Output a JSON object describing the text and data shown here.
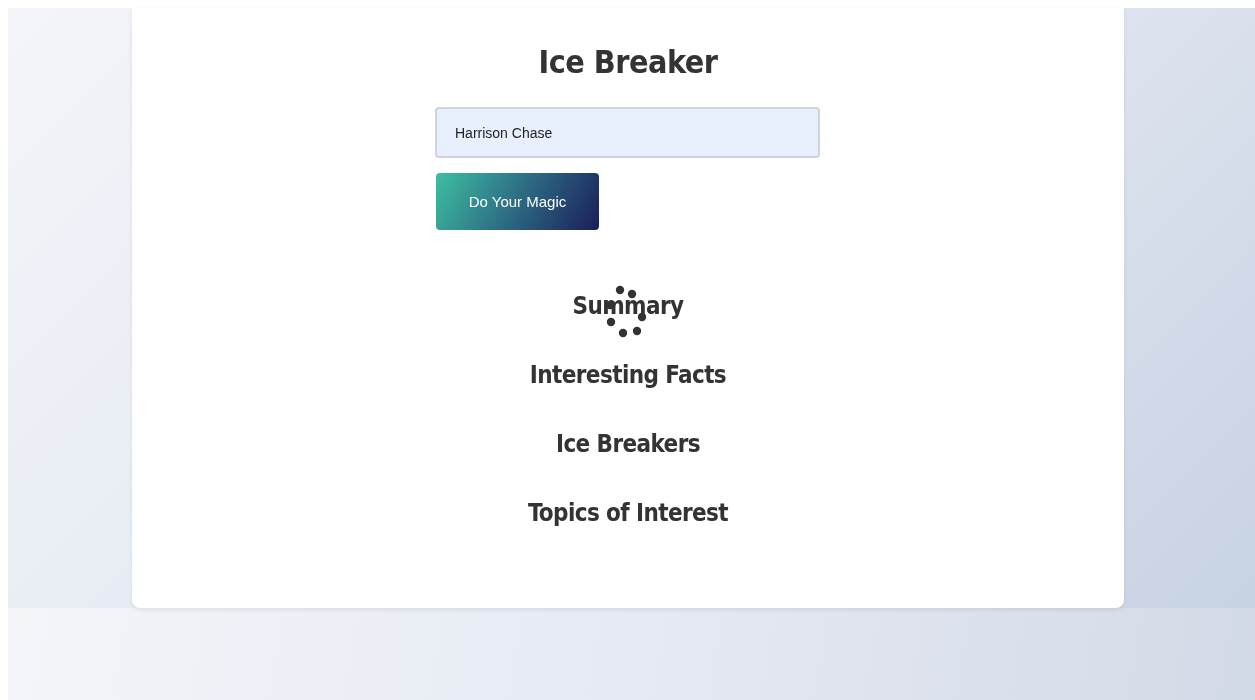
{
  "title": "Ice Breaker",
  "name_field": {
    "value": "Harrison Chase"
  },
  "submit_button": {
    "label": "Do Your Magic"
  },
  "loading": true,
  "sections": [
    {
      "heading": "Summary"
    },
    {
      "heading": "Interesting Facts"
    },
    {
      "heading": "Ice Breakers"
    },
    {
      "heading": "Topics of Interest"
    }
  ]
}
